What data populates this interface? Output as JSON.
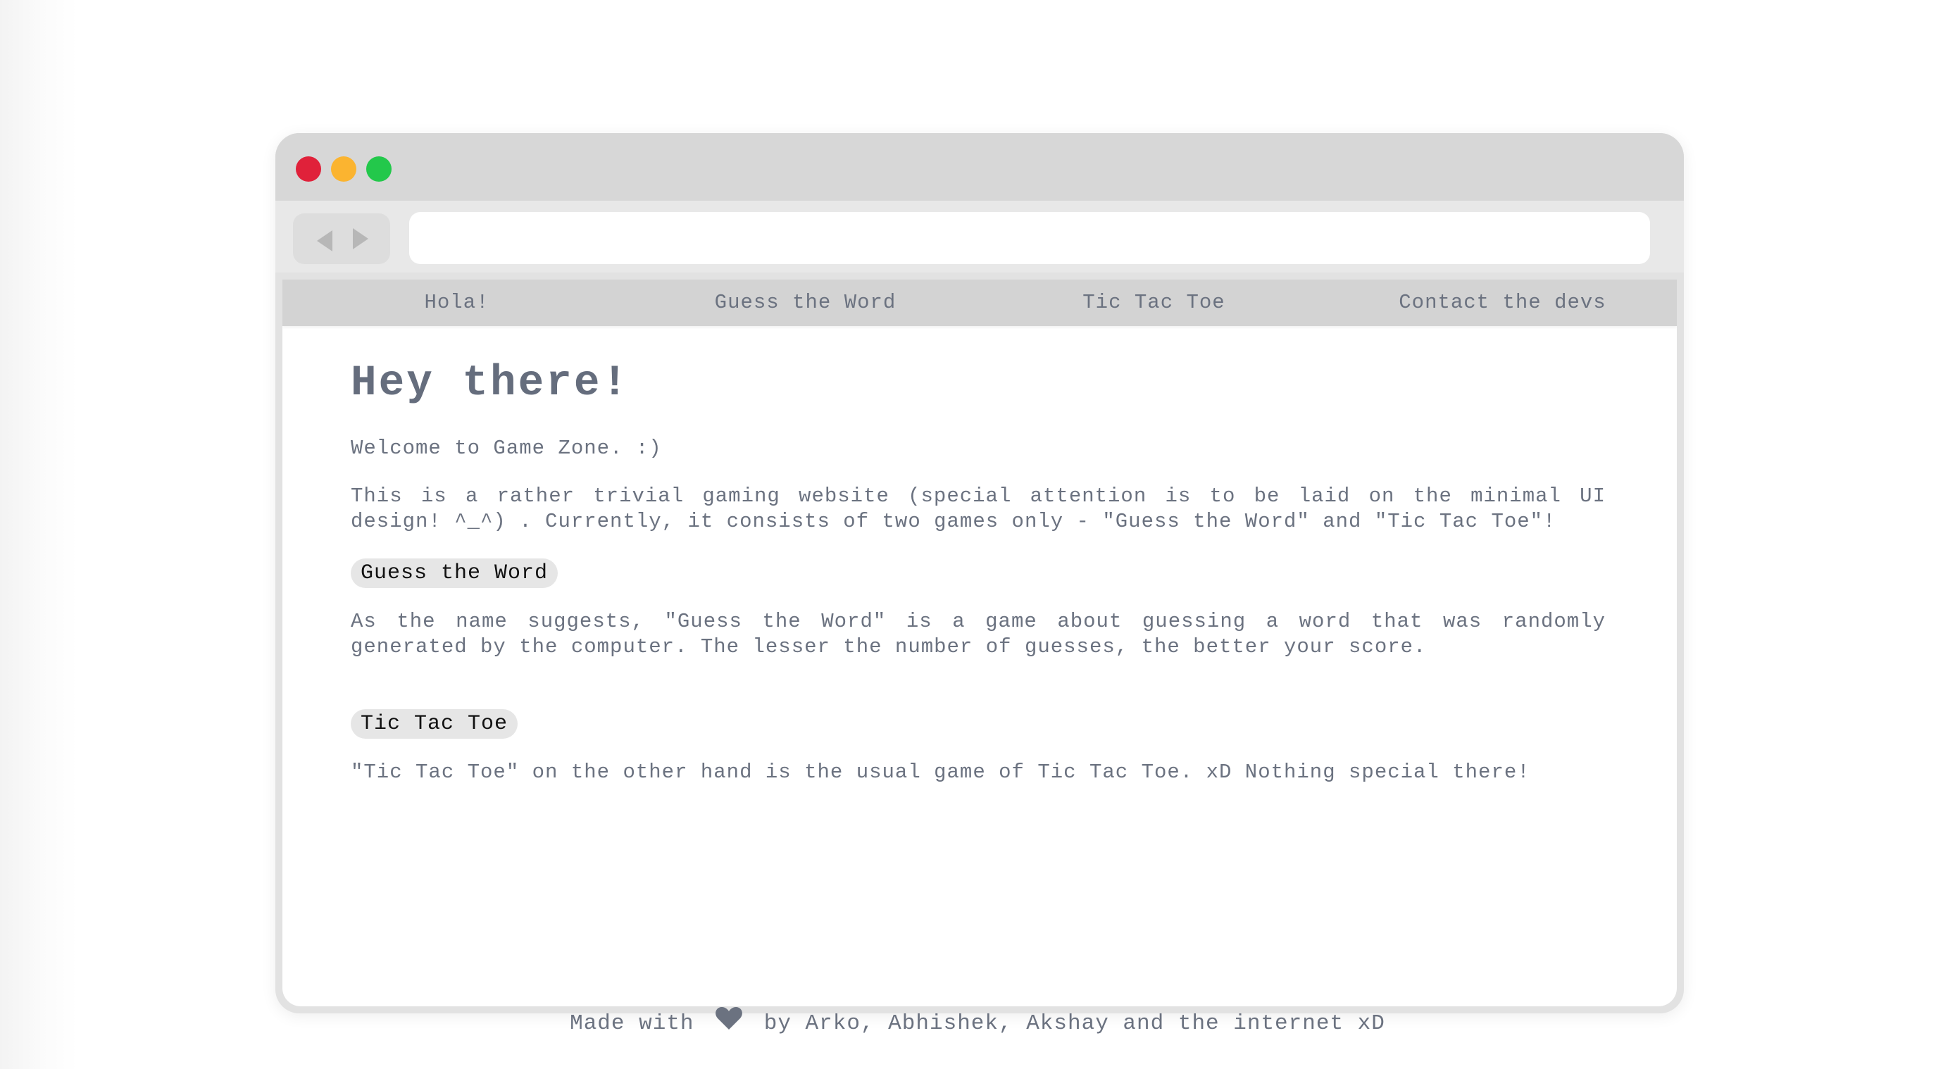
{
  "browser": {
    "address_value": "",
    "traffic_lights": {
      "close": "#e0213a",
      "minimize": "#fbb430",
      "maximize": "#23c84b"
    }
  },
  "site_nav": {
    "items": [
      {
        "label": "Hola!"
      },
      {
        "label": "Guess the Word"
      },
      {
        "label": "Tic Tac Toe"
      },
      {
        "label": "Contact the devs"
      }
    ]
  },
  "main": {
    "title": "Hey there!",
    "welcome": "Welcome to Game Zone. :)",
    "intro": "This is a rather trivial gaming website (special attention is to be laid on the minimal UI design! ^_^) . Currently, it consists of two games only - \"Guess the Word\" and \"Tic Tac Toe\"!",
    "sections": [
      {
        "pill": "Guess the Word",
        "description": "As the name suggests, \"Guess the Word\" is a game about guessing a word that was randomly generated by the computer. The lesser the number of guesses, the better your score."
      },
      {
        "pill": "Tic Tac Toe",
        "description": "\"Tic Tac Toe\" on the other hand is the usual game of Tic Tac Toe. xD Nothing special there!"
      }
    ]
  },
  "footer": {
    "prefix": "Made with",
    "icon": "heart-icon",
    "suffix": "by Arko, Abhishek, Akshay and the internet xD"
  },
  "colors": {
    "text": "#6b7280",
    "nav_bg": "#d3d3d3",
    "pill_bg": "#e6e6e6",
    "heart": "#6b7280"
  }
}
